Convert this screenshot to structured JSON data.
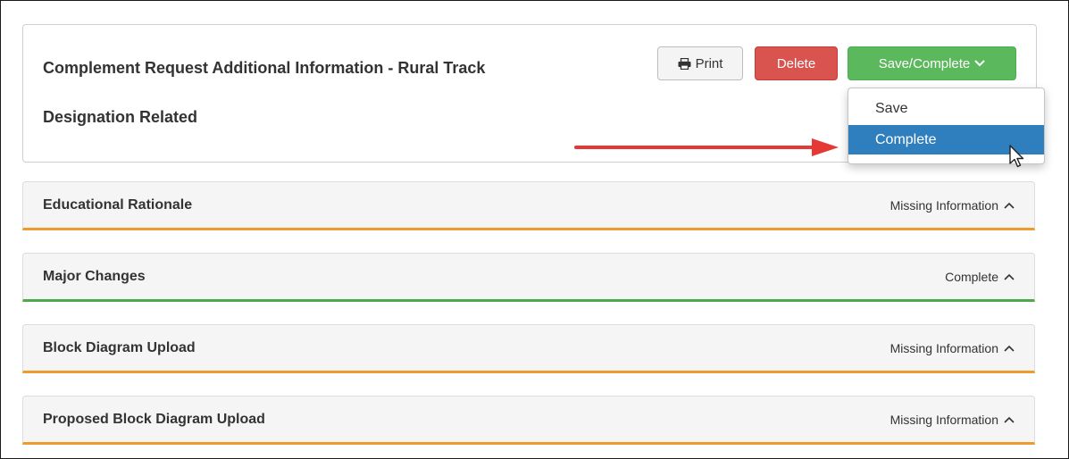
{
  "header": {
    "title_line1": "Complement Request Additional Information - Rural Track",
    "title_line2": "Designation Related"
  },
  "toolbar": {
    "print_label": "Print",
    "delete_label": "Delete",
    "save_complete_label": "Save/Complete"
  },
  "dropdown": {
    "items": [
      {
        "label": "Save",
        "highlighted": false
      },
      {
        "label": "Complete",
        "highlighted": true
      }
    ]
  },
  "sections": [
    {
      "title": "Educational Rationale",
      "status": "Missing Information",
      "status_color": "#ef9a2e"
    },
    {
      "title": "Major Changes",
      "status": "Complete",
      "status_color": "#4caa4c"
    },
    {
      "title": "Block Diagram Upload",
      "status": "Missing Information",
      "status_color": "#ef9a2e"
    },
    {
      "title": "Proposed Block Diagram Upload",
      "status": "Missing Information",
      "status_color": "#ef9a2e"
    }
  ],
  "colors": {
    "delete": "#d9534f",
    "save_complete": "#5cb85c",
    "dropdown_highlight": "#2f7ebd",
    "annotation_arrow": "#e53935"
  },
  "icons": {
    "print": "printer-icon",
    "save_dropdown": "chevron-down-icon",
    "section_toggle": "chevron-up-icon",
    "annotation": "red-arrow-icon",
    "pointer": "mouse-cursor-icon"
  }
}
